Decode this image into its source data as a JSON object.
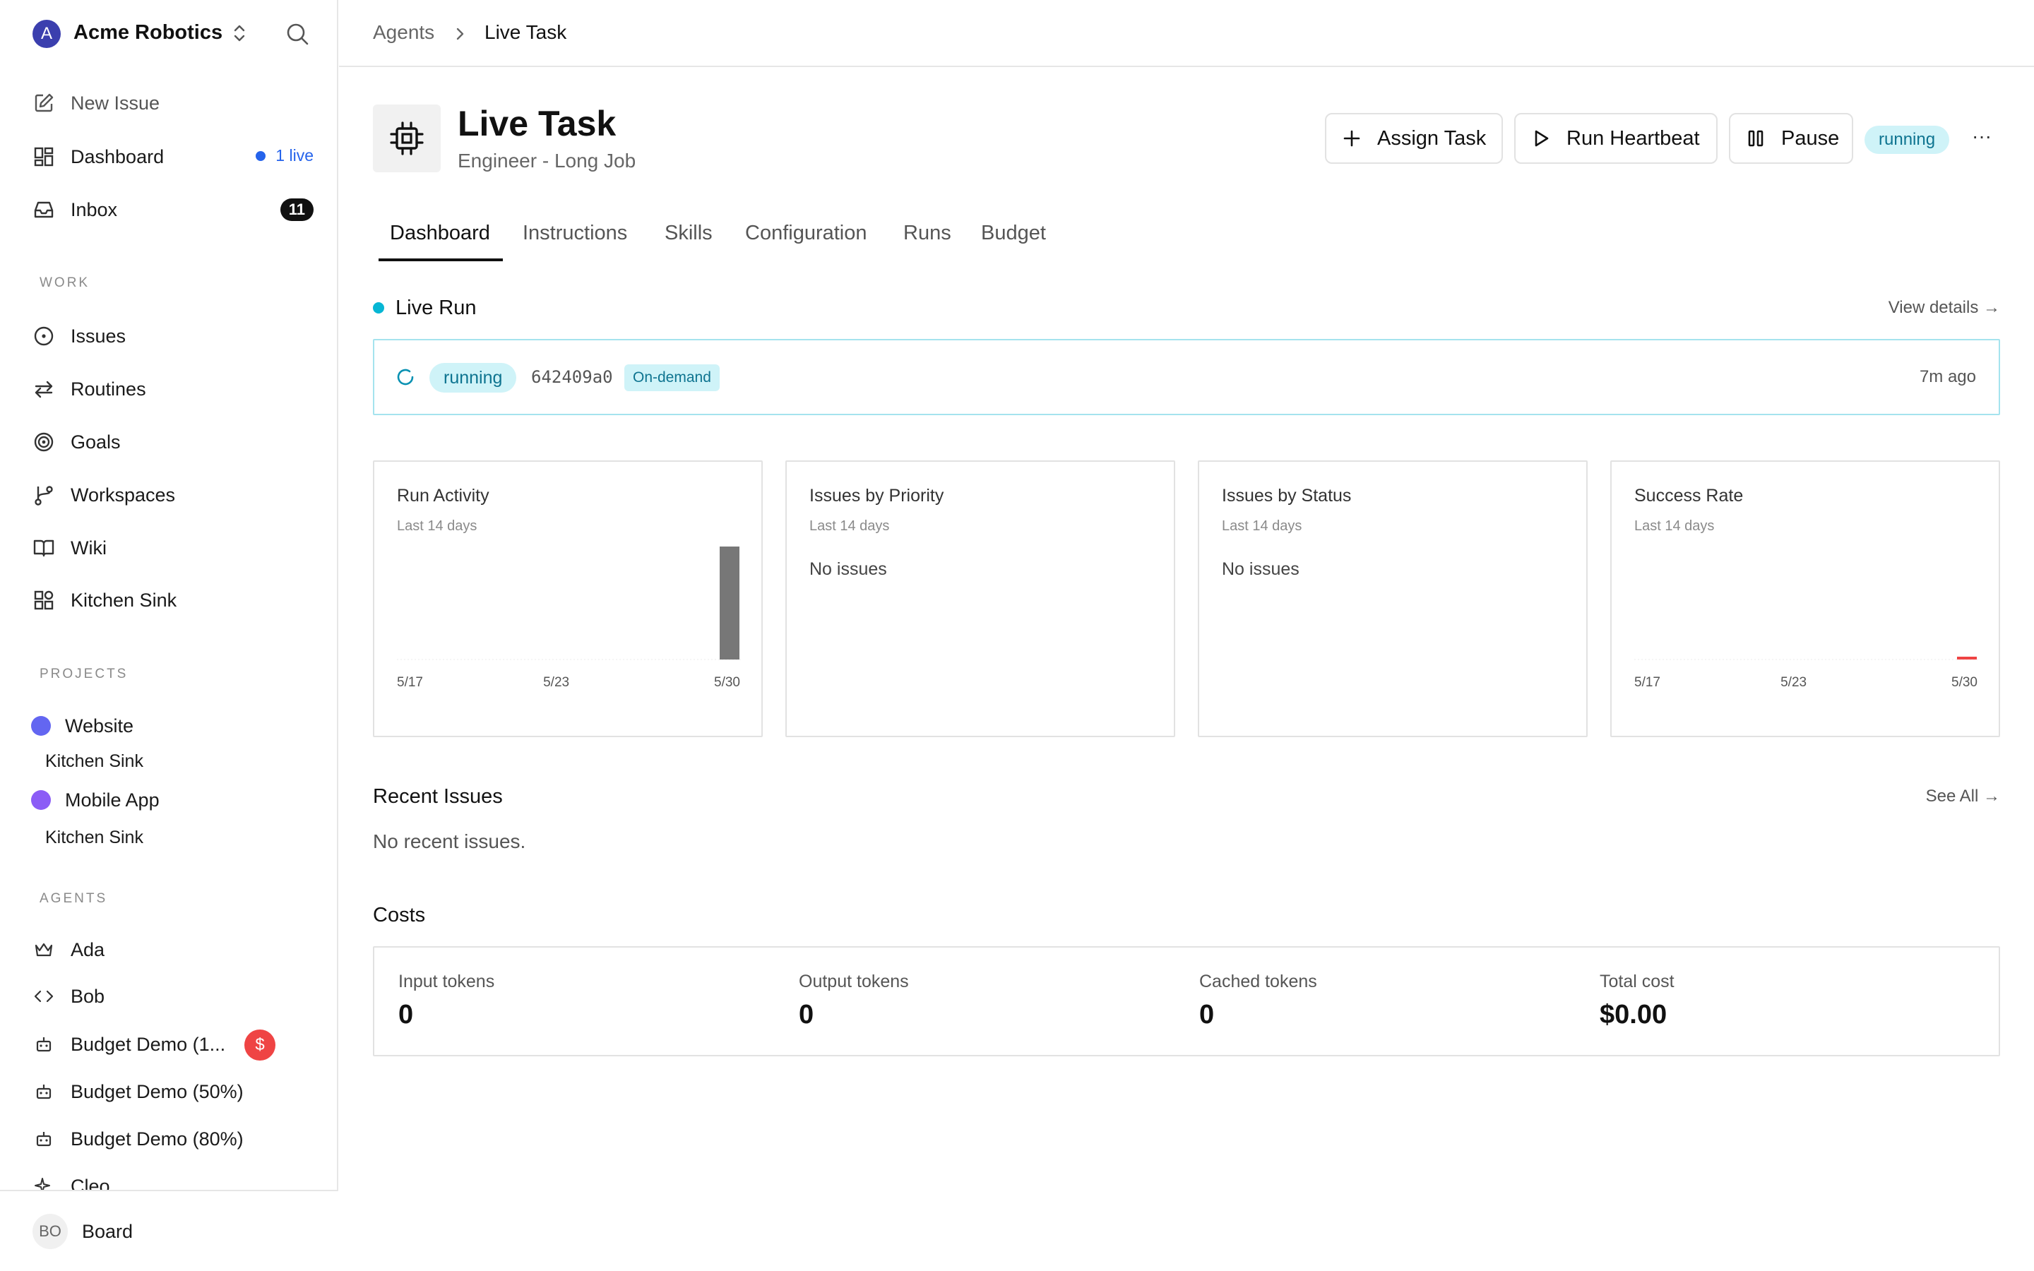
{
  "sidebar": {
    "org_initial": "A",
    "org_name": "Acme Robotics",
    "nav": [
      {
        "label": "New Issue",
        "icon": "new-issue-icon"
      },
      {
        "label": "Dashboard",
        "icon": "dashboard-icon",
        "live_badge": "1 live"
      },
      {
        "label": "Inbox",
        "icon": "inbox-icon",
        "count": "11"
      }
    ],
    "work_label": "WORK",
    "work_items": [
      {
        "label": "Issues",
        "icon": "issues-icon"
      },
      {
        "label": "Routines",
        "icon": "routines-icon"
      },
      {
        "label": "Goals",
        "icon": "goals-icon"
      },
      {
        "label": "Workspaces",
        "icon": "workspaces-icon"
      },
      {
        "label": "Wiki",
        "icon": "wiki-icon"
      },
      {
        "label": "Kitchen Sink",
        "icon": "kitchen-sink-icon"
      }
    ],
    "projects_label": "PROJECTS",
    "projects": [
      {
        "label": "Website",
        "color": "#6366f1",
        "sub": "Kitchen Sink"
      },
      {
        "label": "Mobile App",
        "color": "#8b5cf6",
        "sub": "Kitchen Sink"
      }
    ],
    "agents_label": "AGENTS",
    "agents": [
      {
        "label": "Ada",
        "icon": "crown-icon"
      },
      {
        "label": "Bob",
        "icon": "code-icon"
      },
      {
        "label": "Budget Demo (1...",
        "icon": "bot-icon",
        "badge": "$"
      },
      {
        "label": "Budget Demo (50%)",
        "icon": "bot-icon"
      },
      {
        "label": "Budget Demo (80%)",
        "icon": "bot-icon"
      },
      {
        "label": "Cleo",
        "icon": "sparkle-icon"
      }
    ],
    "user": {
      "initials": "BO",
      "name": "Board"
    }
  },
  "breadcrumb": {
    "parent": "Agents",
    "current": "Live Task"
  },
  "agent": {
    "title": "Live Task",
    "subtitle": "Engineer - Long Job",
    "status": "running"
  },
  "actions": {
    "assign": "Assign Task",
    "heartbeat": "Run Heartbeat",
    "pause": "Pause",
    "more": "···"
  },
  "tabs": [
    "Dashboard",
    "Instructions",
    "Skills",
    "Configuration",
    "Runs",
    "Budget"
  ],
  "live_run": {
    "title": "Live Run",
    "view_details": "View details →",
    "status": "running",
    "run_id": "642409a0",
    "trigger": "On-demand",
    "time": "7m ago"
  },
  "cards": {
    "run_activity": {
      "title": "Run Activity",
      "sub": "Last 14 days"
    },
    "issues_priority": {
      "title": "Issues by Priority",
      "sub": "Last 14 days",
      "empty": "No issues"
    },
    "issues_status": {
      "title": "Issues by Status",
      "sub": "Last 14 days",
      "empty": "No issues"
    },
    "success_rate": {
      "title": "Success Rate",
      "sub": "Last 14 days"
    }
  },
  "chart_data": [
    {
      "type": "bar",
      "title": "Run Activity",
      "categories": [
        "5/17",
        "5/18",
        "5/19",
        "5/20",
        "5/21",
        "5/22",
        "5/23",
        "5/24",
        "5/25",
        "5/26",
        "5/27",
        "5/28",
        "5/29",
        "5/30"
      ],
      "tick_labels": [
        "5/17",
        "5/23",
        "5/30"
      ],
      "values": [
        0,
        0,
        0,
        0,
        0,
        0,
        0,
        0,
        0,
        0,
        0,
        0,
        0,
        1
      ],
      "color": "#777777"
    },
    {
      "type": "bar",
      "title": "Success Rate",
      "categories": [
        "5/17",
        "5/18",
        "5/19",
        "5/20",
        "5/21",
        "5/22",
        "5/23",
        "5/24",
        "5/25",
        "5/26",
        "5/27",
        "5/28",
        "5/29",
        "5/30"
      ],
      "tick_labels": [
        "5/17",
        "5/23",
        "5/30"
      ],
      "values": [
        null,
        null,
        null,
        null,
        null,
        null,
        null,
        null,
        null,
        null,
        null,
        null,
        null,
        0
      ],
      "color": "#ef4444"
    }
  ],
  "recent_issues": {
    "title": "Recent Issues",
    "see_all": "See All →",
    "empty": "No recent issues."
  },
  "costs": {
    "title": "Costs",
    "items": [
      {
        "label": "Input tokens",
        "value": "0"
      },
      {
        "label": "Output tokens",
        "value": "0"
      },
      {
        "label": "Cached tokens",
        "value": "0"
      },
      {
        "label": "Total cost",
        "value": "$0.00"
      }
    ]
  }
}
